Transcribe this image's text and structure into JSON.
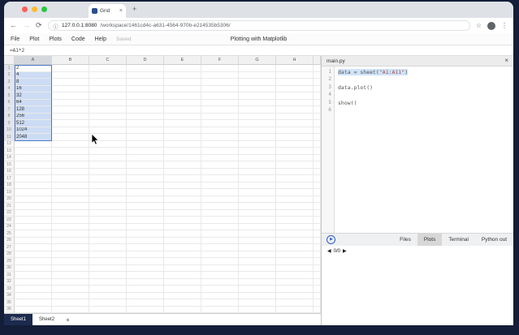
{
  "browser": {
    "tab_title": "Grid",
    "tab_close_icon": "×",
    "new_tab_icon": "+",
    "back_icon": "←",
    "forward_icon": "→",
    "reload_icon": "⟳",
    "info_icon": "ⓘ",
    "url_host": "127.0.0.1:8080",
    "url_path": "/workspace/1461cd4c-a631-4564-970b-e214535b5306/",
    "bookmark_icon": "☆",
    "menu_icon": "⋮"
  },
  "menubar": {
    "items": [
      "File",
      "Plot",
      "Plots",
      "Code",
      "Help"
    ],
    "saved_label": "Saved",
    "document_title": "Plotting with Matplotlib"
  },
  "formula_bar": {
    "value": "=A1*2"
  },
  "spreadsheet": {
    "column_headers": [
      "A",
      "B",
      "C",
      "D",
      "E",
      "F",
      "G",
      "H"
    ],
    "visible_row_count": 36,
    "column_a_values": [
      "2",
      "4",
      "8",
      "16",
      "32",
      "64",
      "128",
      "256",
      "512",
      "1024",
      "2048"
    ],
    "selection_range": "A1:A11",
    "selected_column": "A",
    "selected_row_count": 11,
    "sheet_tabs": [
      {
        "label": "Sheet1",
        "active": true
      },
      {
        "label": "Sheet2",
        "active": false
      }
    ],
    "add_sheet_icon": "+"
  },
  "editor": {
    "filename": "main.py",
    "close_icon": "×",
    "code_lines": [
      "data = sheet(\"A1:A11\")",
      "",
      "data.plot()",
      "",
      "show()",
      ""
    ],
    "active_line": 1,
    "run_icon": "▶",
    "panel_tabs": [
      {
        "label": "Files",
        "active": false
      },
      {
        "label": "Plots",
        "active": true
      },
      {
        "label": "Terminal",
        "active": false
      },
      {
        "label": "Python out",
        "active": false
      }
    ],
    "plots_nav": {
      "prev_icon": "◀",
      "counter": "0/0",
      "next_icon": "▶"
    }
  },
  "colors": {
    "frame": "#141e38",
    "selection_fill": "#ccdcf4",
    "selection_border": "#4d79c9",
    "active_sheet_tab": "#1c2a4e",
    "accent_blue": "#2b5ec9",
    "traffic_close": "#ff5f57",
    "traffic_min": "#febc2e",
    "traffic_max": "#28c840"
  }
}
